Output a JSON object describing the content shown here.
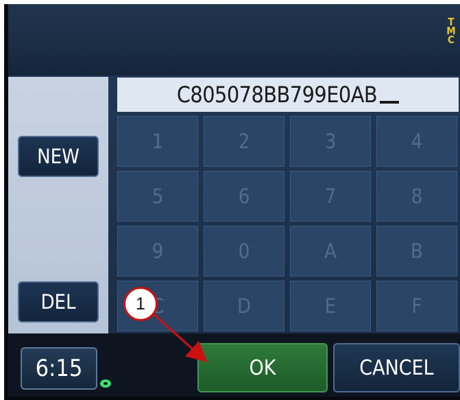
{
  "topbar": {
    "tmc_indicator": [
      "T",
      "M",
      "C"
    ]
  },
  "side_buttons": {
    "new_label": "NEW",
    "del_label": "DEL"
  },
  "entry": {
    "value": "C805078BB799E0AB"
  },
  "keypad": {
    "keys": [
      "1",
      "2",
      "3",
      "4",
      "5",
      "6",
      "7",
      "8",
      "9",
      "0",
      "A",
      "B",
      "C",
      "D",
      "E",
      "F"
    ]
  },
  "bottombar": {
    "clock": "6:15",
    "ok_label": "OK",
    "cancel_label": "CANCEL"
  },
  "annotation": {
    "callout_number": "1"
  },
  "colors": {
    "accent_ok": "#2f7a3b",
    "tmc": "#e8c531",
    "callout": "#cc1111",
    "disc_indicator": "#3fdc6a"
  }
}
